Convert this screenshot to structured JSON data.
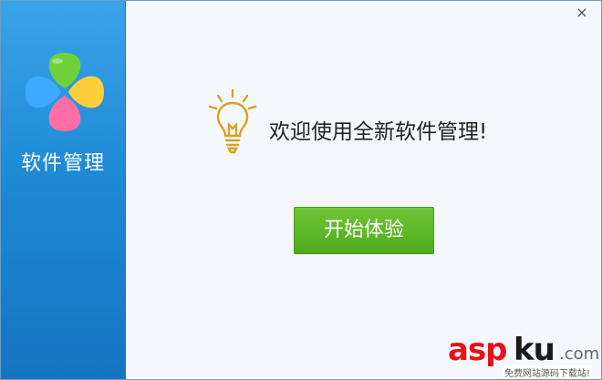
{
  "app": {
    "sidebar_title": "软件管理"
  },
  "main": {
    "welcome_text": "欢迎使用全新软件管理!",
    "start_button_label": "开始体验"
  },
  "controls": {
    "close_glyph": "×"
  },
  "watermark": {
    "brand_red": "asp",
    "brand_dark": "ku",
    "brand_suffix": ".com",
    "tagline": "免费网站源码下载站!"
  },
  "colors": {
    "sidebar_blue": "#1f8ad6",
    "button_green": "#5bb526",
    "bulb_gold": "#d9a21c",
    "petal_green": "#6fd13a",
    "petal_blue": "#3fa9ff",
    "petal_yellow": "#ffcf3a",
    "petal_pink": "#ff6fa6"
  },
  "icons": {
    "logo": "four-petal-logo-icon",
    "bulb": "lightbulb-icon",
    "close": "close-icon"
  }
}
